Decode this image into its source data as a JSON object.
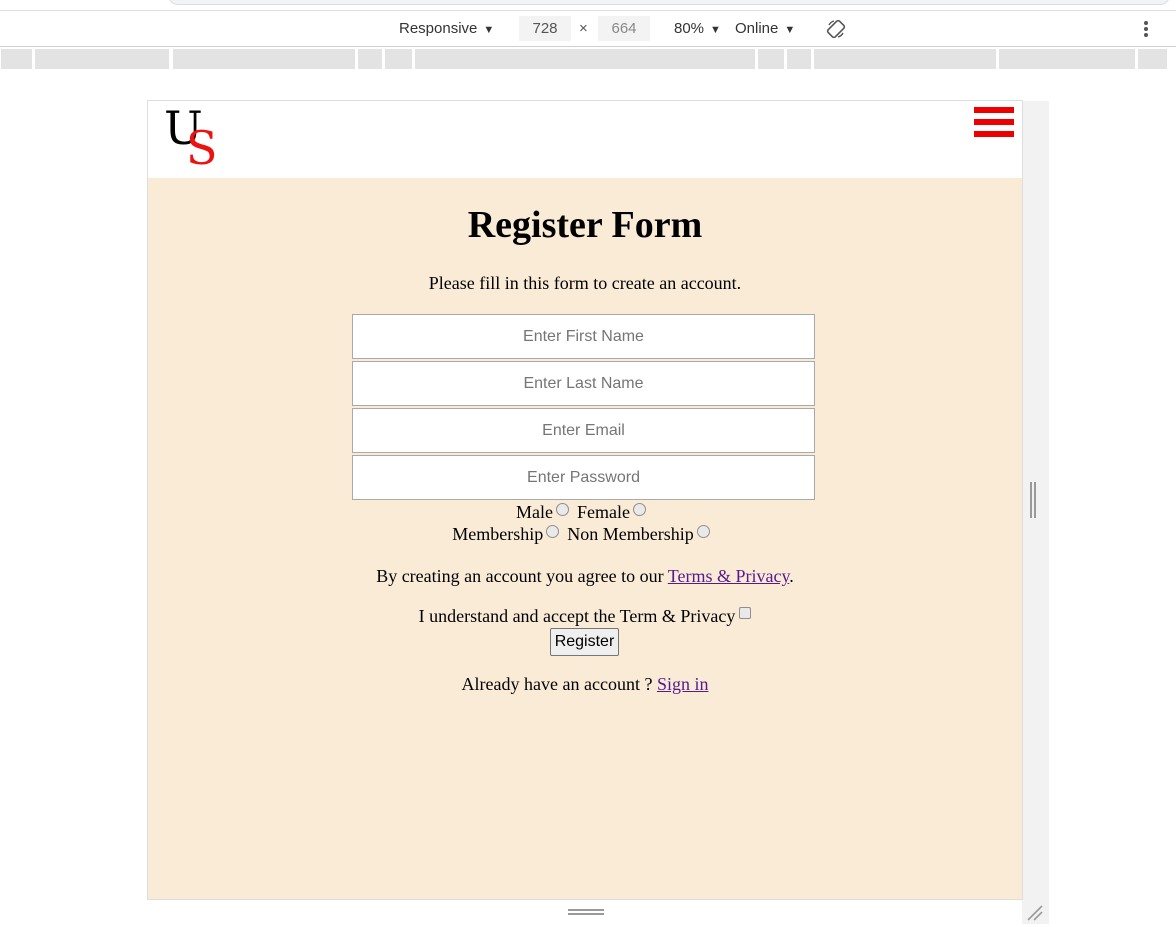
{
  "devtools": {
    "device_mode": "Responsive",
    "width": "728",
    "height": "664",
    "times": "×",
    "zoom": "80%",
    "throttling": "Online",
    "caret": "▼",
    "icons": [
      "rotate-icon",
      "more-vert-icon"
    ]
  },
  "site": {
    "logo": {
      "first": "U",
      "second": "S"
    },
    "menu_icon": "hamburger-menu-icon"
  },
  "form": {
    "title": "Register Form",
    "subtitle": "Please fill in this form to create an account.",
    "fields": {
      "first_name_placeholder": "Enter First Name",
      "last_name_placeholder": "Enter Last Name",
      "email_placeholder": "Enter Email",
      "password_placeholder": "Enter Password"
    },
    "gender": {
      "male": "Male",
      "female": "Female"
    },
    "membership": {
      "member": "Membership",
      "non_member": "Non Membership"
    },
    "terms_text": "By creating an account you agree to our ",
    "terms_link": "Terms & Privacy",
    "terms_end": ".",
    "accept_label": "I understand and accept the Term & Privacy",
    "register_label": "Register",
    "signin_text": "Already have an account ? ",
    "signin_link": "Sign in"
  },
  "colors": {
    "page_bg": "#faebd7",
    "logo_red": "#ee1111",
    "menu_red": "#ee0000",
    "link": "#551a8b"
  }
}
